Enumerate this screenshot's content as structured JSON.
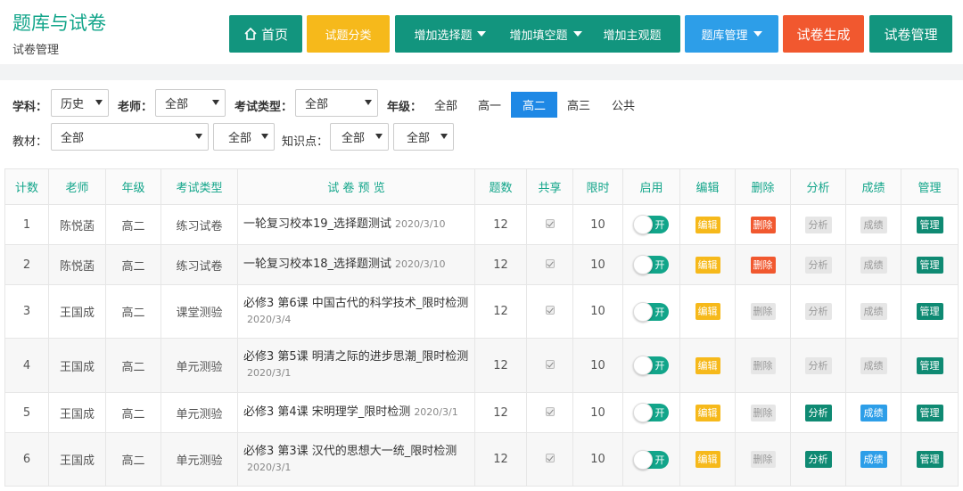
{
  "header": {
    "title": "题库与试卷",
    "subtitle": "试卷管理",
    "nav": {
      "home": "首页",
      "categories": "试题分类",
      "add_choice": "增加选择题",
      "add_blank": "增加填空题",
      "add_subjective": "增加主观题",
      "bank_manage": "题库管理",
      "generate": "试卷生成",
      "paper_manage": "试卷管理"
    }
  },
  "filters": {
    "subject_label": "学科：",
    "subject_value": "历史",
    "teacher_label": "老师：",
    "teacher_value": "全部",
    "exam_type_label": "考试类型：",
    "exam_type_value": "全部",
    "grade_label": "年级：",
    "grades": [
      "全部",
      "高一",
      "高二",
      "高三",
      "公共"
    ],
    "grade_selected": "高二",
    "textbook_label": "教材：",
    "textbook_value": "全部",
    "textbook_sub_value": "全部",
    "knowledge_label": "知识点：",
    "knowledge_value": "全部",
    "knowledge_sub_value": "全部"
  },
  "table": {
    "headers": [
      "计数",
      "老师",
      "年级",
      "考试类型",
      "试 卷 预 览",
      "题数",
      "共享",
      "限时",
      "启用",
      "编辑",
      "删除",
      "分析",
      "成绩",
      "管理"
    ],
    "toggle_label": "开",
    "edit_label": "编辑",
    "delete_label": "删除",
    "analyze_label": "分析",
    "score_label": "成绩",
    "manage_label": "管理",
    "rows": [
      {
        "no": "1",
        "teacher": "陈悦菡",
        "grade": "高二",
        "type": "练习试卷",
        "title": "一轮复习校本19_选择题测试",
        "date": "2020/3/10",
        "count": "12",
        "limit": "10",
        "delete_active": true,
        "analyze_active": false,
        "score_active": false
      },
      {
        "no": "2",
        "teacher": "陈悦菡",
        "grade": "高二",
        "type": "练习试卷",
        "title": "一轮复习校本18_选择题测试",
        "date": "2020/3/10",
        "count": "12",
        "limit": "10",
        "delete_active": true,
        "analyze_active": false,
        "score_active": false
      },
      {
        "no": "3",
        "teacher": "王国成",
        "grade": "高二",
        "type": "课堂测验",
        "title": "必修3 第6课 中国古代的科学技术_限时检测",
        "date": "2020/3/4",
        "count": "12",
        "limit": "10",
        "delete_active": false,
        "analyze_active": false,
        "score_active": false
      },
      {
        "no": "4",
        "teacher": "王国成",
        "grade": "高二",
        "type": "单元测验",
        "title": "必修3 第5课 明清之际的进步思潮_限时检测",
        "date": "2020/3/1",
        "count": "12",
        "limit": "10",
        "delete_active": false,
        "analyze_active": false,
        "score_active": false
      },
      {
        "no": "5",
        "teacher": "王国成",
        "grade": "高二",
        "type": "单元测验",
        "title": "必修3 第4课 宋明理学_限时检测",
        "date": "2020/3/1",
        "count": "12",
        "limit": "10",
        "delete_active": false,
        "analyze_active": true,
        "score_active": true
      },
      {
        "no": "6",
        "teacher": "王国成",
        "grade": "高二",
        "type": "单元测验",
        "title": "必修3 第3课 汉代的思想大一统_限时检测",
        "date": "2020/3/1",
        "count": "12",
        "limit": "10",
        "delete_active": false,
        "analyze_active": true,
        "score_active": true
      }
    ]
  },
  "colors": {
    "brand": "#12a58a",
    "nav_green": "#12957e",
    "nav_yellow": "#f6b91b",
    "nav_blue": "#2d9ee8",
    "nav_red": "#f1582f",
    "grade_active": "#1e88e5"
  },
  "icons": [
    "home-icon",
    "chevron-down-icon",
    "checkbox-icon"
  ]
}
